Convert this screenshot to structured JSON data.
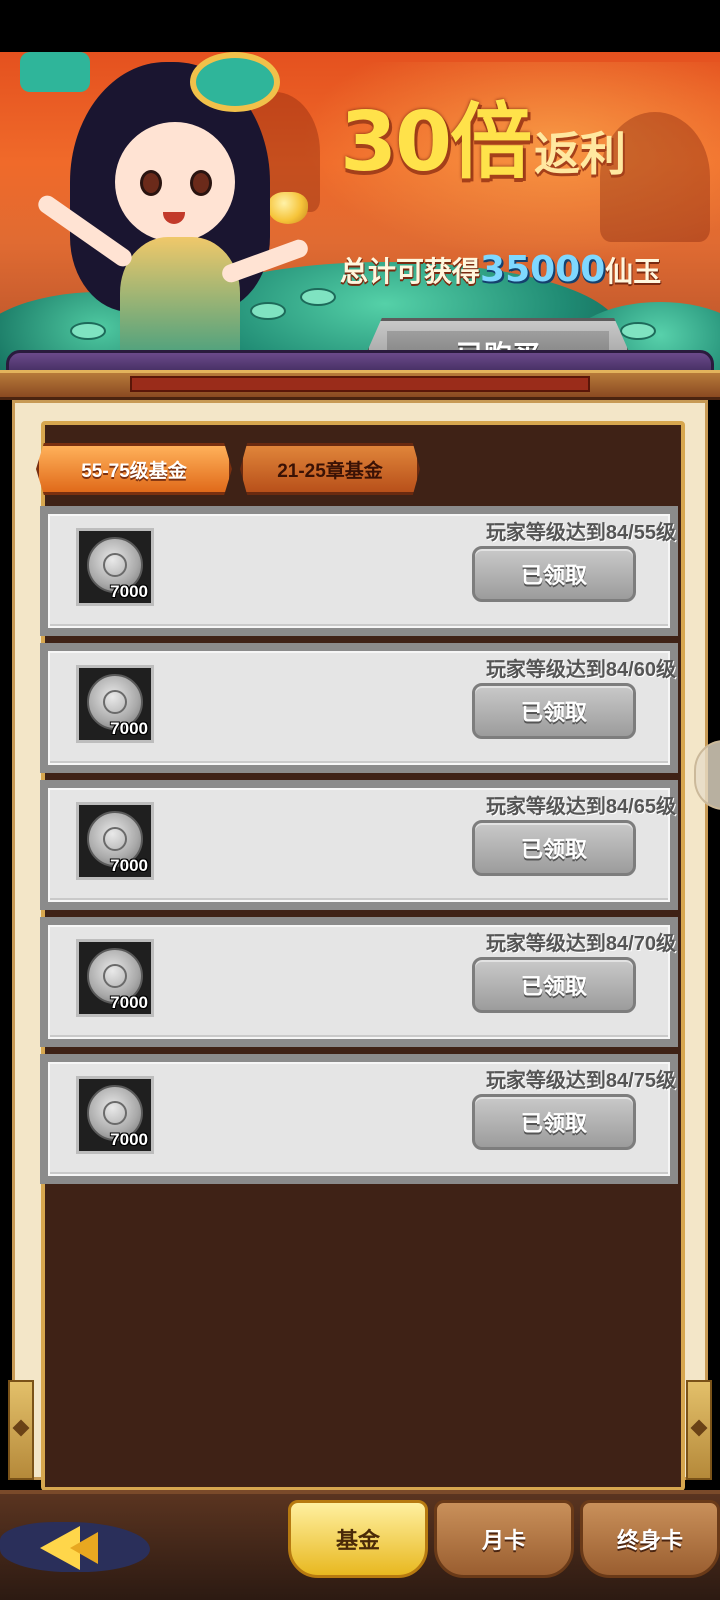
{
  "banner": {
    "promo_big": "30倍",
    "promo_sub": "返利",
    "promo_line_prefix": "总计可获得",
    "promo_line_amount": "35000",
    "promo_line_suffix": "仙玉",
    "buy_button_label": "已购买"
  },
  "tabs": [
    {
      "label": "55-75级基金",
      "active": true
    },
    {
      "label": "21-25章基金",
      "active": false
    }
  ],
  "rewards": [
    {
      "requirement": "玩家等级达到84/55级",
      "item_qty": "7000",
      "item_glyph": "玉",
      "button_label": "已领取"
    },
    {
      "requirement": "玩家等级达到84/60级",
      "item_qty": "7000",
      "item_glyph": "玉",
      "button_label": "已领取"
    },
    {
      "requirement": "玩家等级达到84/65级",
      "item_qty": "7000",
      "item_glyph": "玉",
      "button_label": "已领取"
    },
    {
      "requirement": "玩家等级达到84/70级",
      "item_qty": "7000",
      "item_glyph": "玉",
      "button_label": "已领取"
    },
    {
      "requirement": "玩家等级达到84/75级",
      "item_qty": "7000",
      "item_glyph": "玉",
      "button_label": "已领取"
    }
  ],
  "bottom_nav": [
    {
      "label": "基金",
      "active": true
    },
    {
      "label": "月卡",
      "active": false
    },
    {
      "label": "终身卡",
      "active": false
    }
  ],
  "icons": {
    "back": "back-arrow-icon",
    "currency": "jade-coin-icon"
  },
  "colors": {
    "active_tab": "#e06a1a",
    "claimed_button": "#9c9c9c",
    "gold_text": "#ffe24a",
    "amount_text": "#7fd8ff"
  }
}
